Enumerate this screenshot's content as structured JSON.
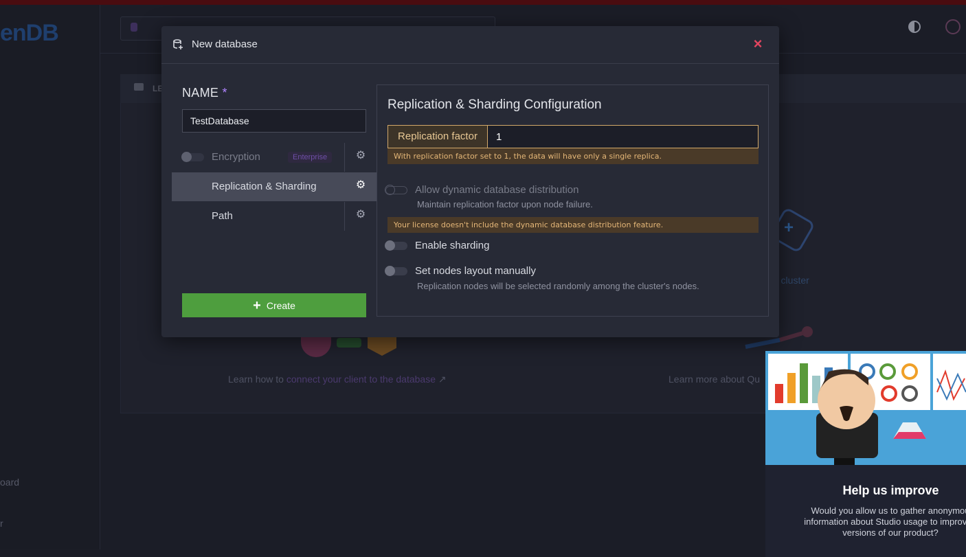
{
  "app": {
    "logo_text": "enDB",
    "sidebar_items": [
      "oard",
      "r"
    ],
    "panel_title": "LE",
    "learn_connect_prefix": "Learn how to ",
    "learn_connect_link": "connect your client to the database",
    "learn_more": "Learn more about Qu",
    "cluster_hint": "r cluster"
  },
  "modal": {
    "title": "New database",
    "close_label": "×",
    "name_label": "NAME",
    "required_mark": "*",
    "name_value": "TestDatabase",
    "options": [
      {
        "label": "Encryption",
        "badge": "Enterprise",
        "state": "disabled"
      },
      {
        "label": "Replication & Sharding",
        "state": "active"
      },
      {
        "label": "Path",
        "state": "normal"
      }
    ],
    "create_label": "Create"
  },
  "config": {
    "title": "Replication & Sharding Configuration",
    "replication_factor_label": "Replication factor",
    "replication_factor_value": "1",
    "replication_warning": "With replication factor set to 1, the data will have only a single replica.",
    "dynamic_label": "Allow dynamic database distribution",
    "dynamic_help": "Maintain replication factor upon node failure.",
    "license_warning": "Your license doesn't include the dynamic database distribution feature.",
    "sharding_label": "Enable sharding",
    "layout_label": "Set nodes layout manually",
    "layout_help": "Replication nodes will be selected randomly among the cluster's nodes."
  },
  "help_popup": {
    "title": "Help us improve",
    "text": "Would you allow us to gather anonymou\ninformation about Studio usage to improve t\nversions of our product?"
  },
  "colors": {
    "accent_required": "#b084ff",
    "close": "#e2455f",
    "create": "#4e9e3e",
    "warning_bg": "#4a3a28",
    "warning_text": "#e5b778"
  }
}
